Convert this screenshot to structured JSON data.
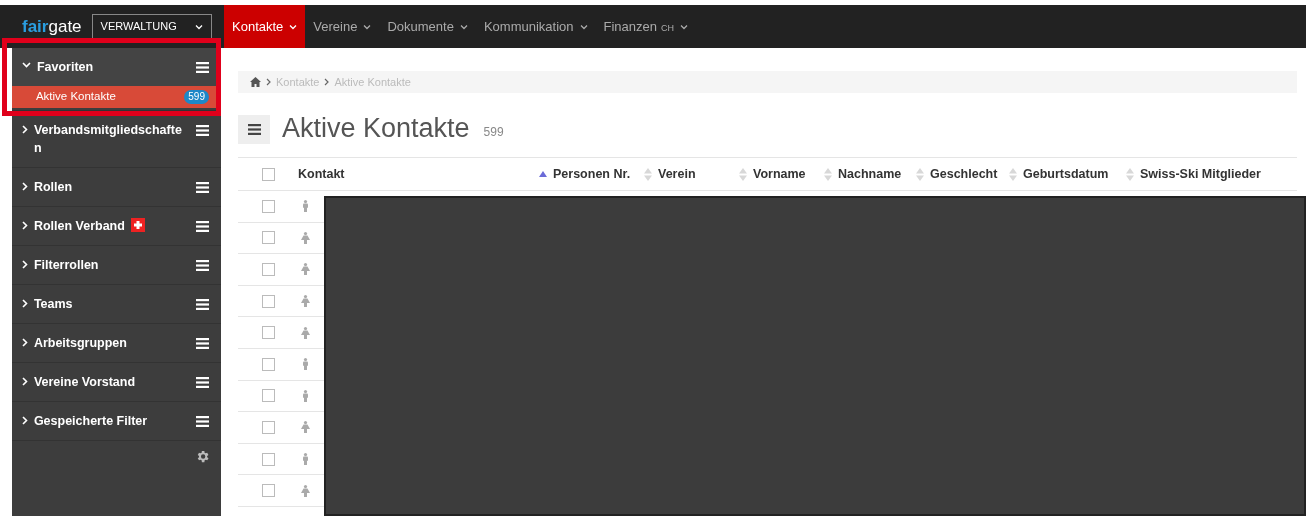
{
  "logo": {
    "accent": "fair",
    "rest": "gate"
  },
  "area_select": {
    "value": "VERWALTUNG"
  },
  "nav": [
    {
      "label": "Kontakte",
      "selected": true
    },
    {
      "label": "Vereine",
      "selected": false
    },
    {
      "label": "Dokumente",
      "selected": false
    },
    {
      "label": "Kommunikation",
      "selected": false
    },
    {
      "label": "Finanzen",
      "suffix": "CH",
      "selected": false
    }
  ],
  "sidebar": {
    "groups": [
      {
        "label": "Favoriten",
        "expanded": true,
        "children": [
          {
            "label": "Aktive Kontakte",
            "count": "599",
            "selected": true
          }
        ]
      },
      {
        "label": "Verbandsmitgliedschaften",
        "expanded": false
      },
      {
        "label": "Rollen",
        "expanded": false
      },
      {
        "label": "Rollen Verband",
        "flag": true,
        "expanded": false
      },
      {
        "label": "Filterrollen",
        "expanded": false
      },
      {
        "label": "Teams",
        "expanded": false
      },
      {
        "label": "Arbeitsgruppen",
        "expanded": false
      },
      {
        "label": "Vereine Vorstand",
        "expanded": false
      },
      {
        "label": "Gespeicherte Filter",
        "expanded": false
      }
    ],
    "highlighted": true
  },
  "breadcrumb": [
    "Kontakte",
    "Aktive Kontakte"
  ],
  "page_title": "Aktive Kontakte",
  "page_count": "599",
  "table": {
    "all_checked": false,
    "columns": [
      {
        "label": "Kontakt",
        "sorted": true,
        "sortable": true
      },
      {
        "label": "Personen Nr.",
        "sorted": false,
        "sortable": true
      },
      {
        "label": "Verein",
        "sorted": false,
        "sortable": true
      },
      {
        "label": "Vorname",
        "sorted": false,
        "sortable": true
      },
      {
        "label": "Nachname",
        "sorted": false,
        "sortable": true
      },
      {
        "label": "Geschlecht",
        "sorted": false,
        "sortable": true
      },
      {
        "label": "Geburtsdatum",
        "sorted": false,
        "sortable": true
      },
      {
        "label": "Swiss-Ski Mitglieder",
        "sorted": false,
        "sortable": false
      }
    ],
    "rows": [
      {
        "kind": "male",
        "checked": false
      },
      {
        "kind": "female",
        "checked": false
      },
      {
        "kind": "female",
        "checked": false
      },
      {
        "kind": "female",
        "checked": false
      },
      {
        "kind": "female",
        "checked": false
      },
      {
        "kind": "male",
        "checked": false
      },
      {
        "kind": "male",
        "checked": false
      },
      {
        "kind": "female",
        "checked": false
      },
      {
        "kind": "male",
        "checked": false
      },
      {
        "kind": "female",
        "checked": false
      }
    ],
    "redacted": true
  }
}
